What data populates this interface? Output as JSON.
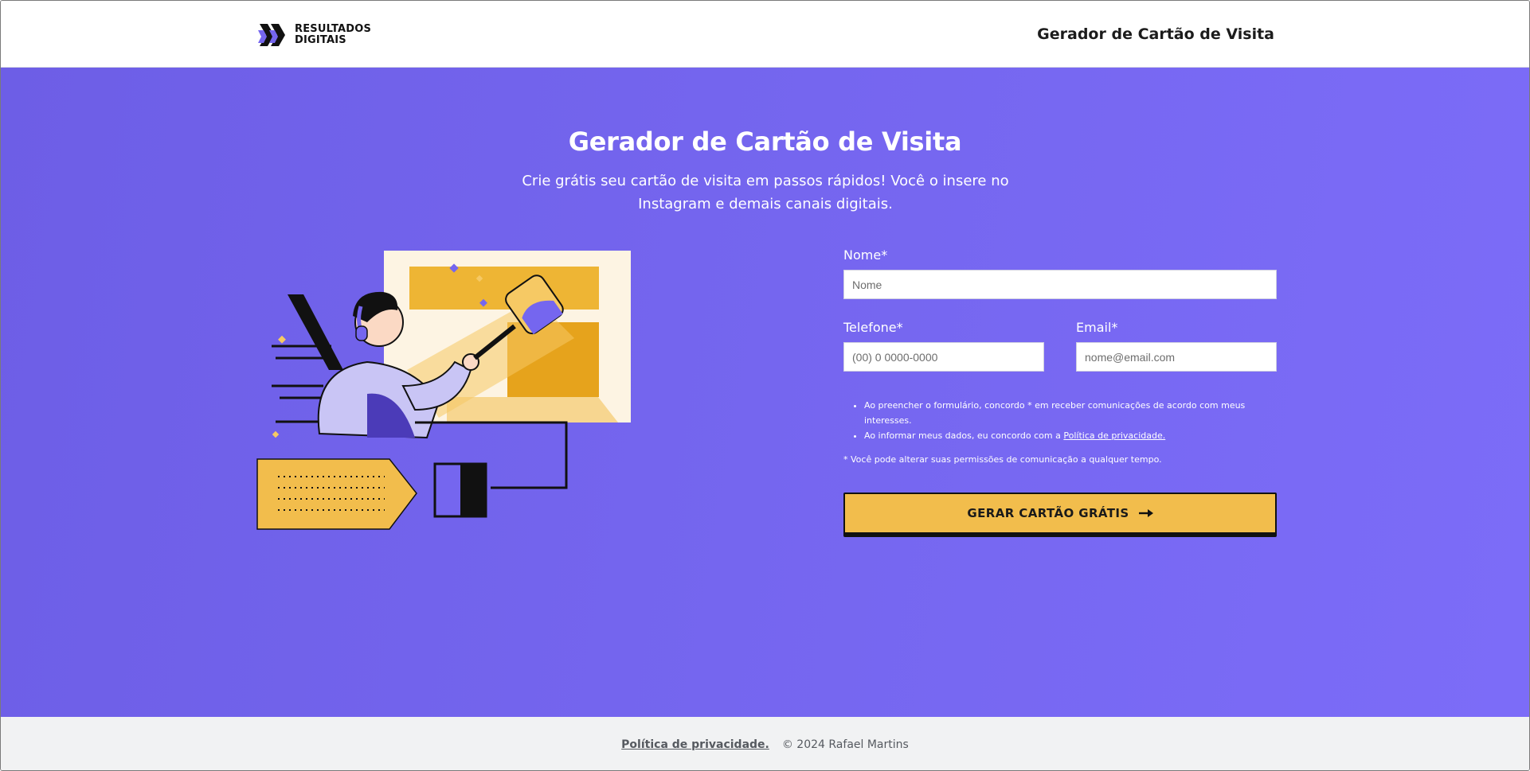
{
  "header": {
    "logo_line1": "RESULTADOS",
    "logo_line2": "DIGITAIS",
    "title": "Gerador de Cartão de Visita"
  },
  "hero": {
    "title": "Gerador de Cartão de Visita",
    "subtitle": "Crie grátis seu cartão de visita em passos rápidos! Você o insere no Instagram e demais canais digitais."
  },
  "form": {
    "name_label": "Nome*",
    "name_placeholder": "Nome",
    "phone_label": "Telefone*",
    "phone_placeholder": "(00) 0 0000-0000",
    "email_label": "Email*",
    "email_placeholder": "nome@email.com",
    "consent_1": "Ao preencher o formulário, concordo * em receber comunicações de acordo com meus interesses.",
    "consent_2_prefix": "Ao informar meus dados, eu concordo com a ",
    "consent_2_link": "Política de privacidade.",
    "note": "* Você pode alterar suas permissões de comunicação a qualquer tempo.",
    "submit_label": "GERAR CARTÃO GRÁTIS",
    "submit_icon": "arrow-right-icon"
  },
  "footer": {
    "privacy_link": "Política de privacidade.",
    "copyright": "© 2024 Rafael Martins"
  },
  "colors": {
    "hero_bg": "#7566ef",
    "accent_yellow": "#f2bd4c",
    "footer_bg": "#f1f2f3"
  }
}
